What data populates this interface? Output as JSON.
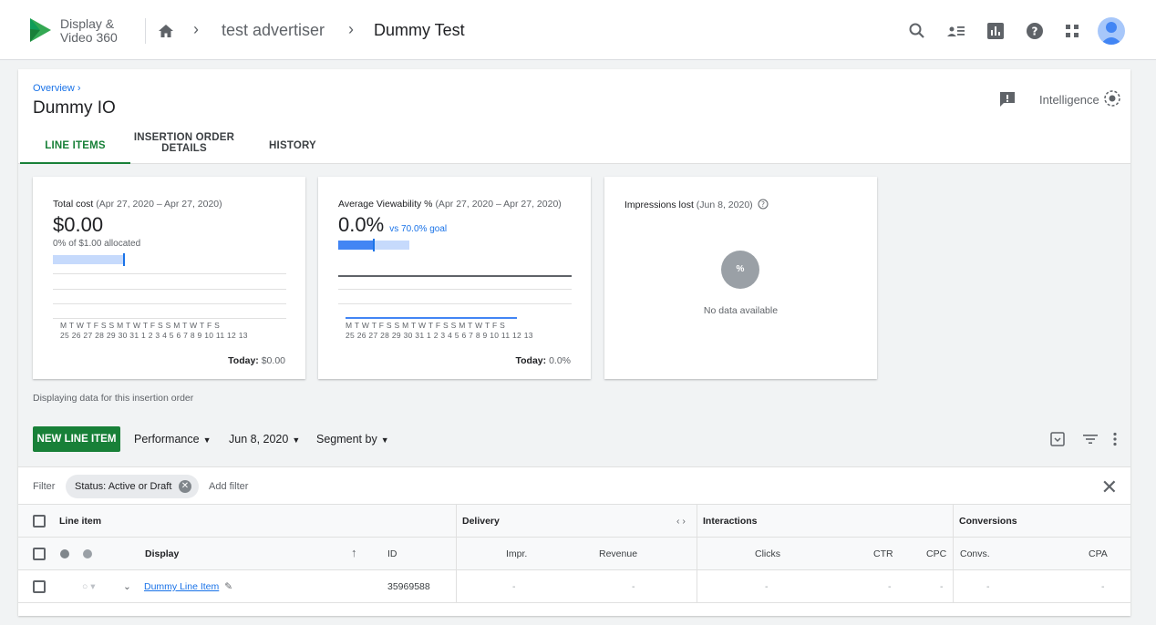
{
  "app": {
    "logo_line1": "Display &",
    "logo_line2": "Video 360"
  },
  "breadcrumb": {
    "advertiser": "test advertiser",
    "campaign": "Dummy Test",
    "separator": "›"
  },
  "page": {
    "overview_link": "Overview ›",
    "title": "Dummy IO",
    "intelligence_label": "Intelligence"
  },
  "tabs": [
    {
      "label": "LINE ITEMS"
    },
    {
      "label_line1": "INSERTION ORDER",
      "label_line2": "DETAILS"
    },
    {
      "label": "HISTORY"
    }
  ],
  "metrics": {
    "total_cost": {
      "label": "Total cost",
      "range": "(Apr 27, 2020 – Apr 27, 2020)",
      "value": "$0.00",
      "sub": "0% of $1.00 allocated",
      "days": "M T W T F S S M T W T F S S M T W T F S",
      "dates": "25 26 27 28 29 30 31 1 2 3 4 5 6 7 8 9 10 11 12 13",
      "today_label": "Today:",
      "today_value": "$0.00",
      "allocated_fraction": 0.3
    },
    "viewability": {
      "label": "Average Viewability %",
      "range": "(Apr 27, 2020 – Apr 27, 2020)",
      "value": "0.0%",
      "goal": "vs 70.0% goal",
      "days": "M T W T F S S M T W T F S S M T W T F S",
      "dates": "25 26 27 28 29 30 31 1 2 3 4 5 6 7 8 9 10 11 12 13",
      "today_label": "Today:",
      "today_value": "0.0%",
      "goal_fraction": 0.7
    },
    "impressions_lost": {
      "label": "Impressions lost",
      "range": "(Jun 8, 2020)",
      "circle_text": "%",
      "empty_text": "No data available"
    }
  },
  "displaying_text": "Displaying data for this insertion order",
  "toolbar": {
    "new_line_item": "NEW LINE ITEM",
    "performance": "Performance",
    "date": "Jun 8, 2020",
    "segment": "Segment by"
  },
  "filter": {
    "label": "Filter",
    "chip": "Status: Active or Draft",
    "add": "Add filter"
  },
  "table": {
    "group_headers": {
      "line_item": "Line item",
      "delivery": "Delivery",
      "interactions": "Interactions",
      "conversions": "Conversions"
    },
    "columns": {
      "display": "Display",
      "id": "ID",
      "impr": "Impr.",
      "revenue": "Revenue",
      "clicks": "Clicks",
      "ctr": "CTR",
      "cpc": "CPC",
      "convs": "Convs.",
      "cpa": "CPA"
    },
    "rows": [
      {
        "name": "Dummy Line Item",
        "id": "35969588",
        "impr": "-",
        "revenue": "-",
        "clicks": "-",
        "ctr": "-",
        "cpc": "-",
        "convs": "-",
        "cpa": "-"
      }
    ]
  },
  "colors": {
    "brand_green": "#188038",
    "link_blue": "#1a73e8",
    "bar_blue": "#4285f4"
  }
}
